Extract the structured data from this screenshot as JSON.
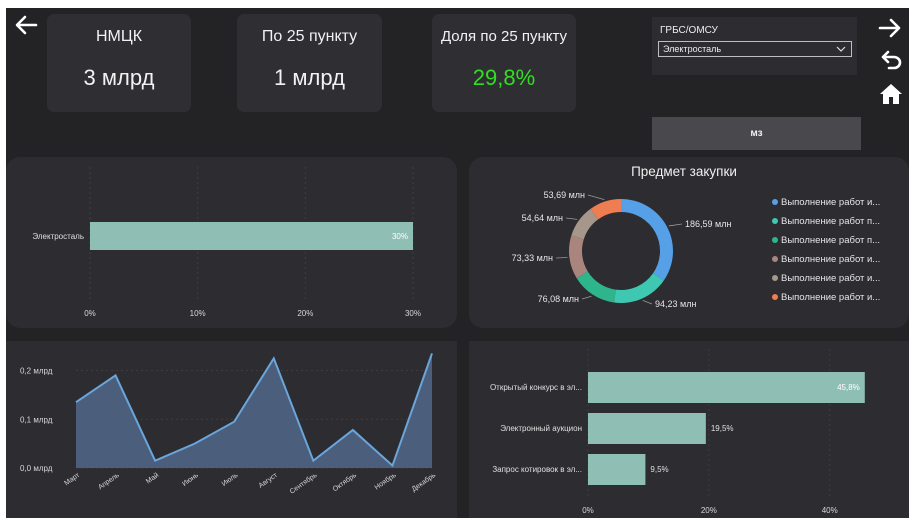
{
  "kpi": {
    "nmck": {
      "title": "НМЦК",
      "value": "3 млрд"
    },
    "p25": {
      "title": "По 25 пункту",
      "value": "1 млрд"
    },
    "share": {
      "title": "Доля по 25 пункту",
      "value": "29,8%",
      "color": "#33dd22"
    }
  },
  "filter": {
    "label": "ГРБС/ОМСУ",
    "selected": "Электросталь"
  },
  "mz_button": "мз",
  "nav": {
    "back_icon": "arrow-left-icon",
    "forward_icon": "arrow-right-icon",
    "undo_icon": "undo-icon",
    "home_icon": "home-icon"
  },
  "chart_data": [
    {
      "type": "bar",
      "orientation": "horizontal",
      "categories": [
        "Электросталь"
      ],
      "values": [
        30
      ],
      "data_labels": [
        "30%"
      ],
      "xticks": [
        "0%",
        "10%",
        "20%",
        "30%"
      ],
      "xlim": [
        0,
        30
      ],
      "color": "#8fbfb4"
    },
    {
      "type": "pie",
      "variant": "donut",
      "title": "Предмет закупки",
      "slices": [
        {
          "legend": "Выполнение работ и...",
          "value": 186.59,
          "label": "186,59 млн",
          "color": "#56a0e8"
        },
        {
          "legend": "Выполнение работ п...",
          "value": 94.23,
          "label": "94,23 млн",
          "color": "#3ec8b2"
        },
        {
          "legend": "Выполнение работ п...",
          "value": 76.08,
          "label": "76,08 млн",
          "color": "#2fb58c"
        },
        {
          "legend": "Выполнение работ и...",
          "value": 73.33,
          "label": "73,33 млн",
          "color": "#a9857e"
        },
        {
          "legend": "Выполнение работ и...",
          "value": 54.64,
          "label": "54,64 млн",
          "color": "#a6978a"
        },
        {
          "legend": "Выполнение работ и...",
          "value": 53.69,
          "label": "53,69 млн",
          "color": "#ee7d52"
        }
      ]
    },
    {
      "type": "area",
      "categories": [
        "Март",
        "Апрель",
        "Май",
        "Июнь",
        "Июль",
        "Август",
        "Сентябрь",
        "Октябрь",
        "Ноябрь",
        "Декабрь"
      ],
      "values": [
        0.135,
        0.19,
        0.015,
        0.05,
        0.095,
        0.225,
        0.015,
        0.078,
        0.005,
        0.235
      ],
      "yticks": [
        {
          "v": 0.0,
          "label": "0,0 млрд"
        },
        {
          "v": 0.1,
          "label": "0,1 млрд"
        },
        {
          "v": 0.2,
          "label": "0,2 млрд"
        }
      ],
      "ylim": [
        0,
        0.24
      ],
      "line_color": "#6aa6dc",
      "fill_color": "#4b5f7c"
    },
    {
      "type": "bar",
      "orientation": "horizontal",
      "categories": [
        "Открытый конкурс в эл...",
        "Электронный аукцион",
        "Запрос котировок в эл..."
      ],
      "values": [
        45.8,
        19.5,
        9.5
      ],
      "data_labels": [
        "45,8%",
        "19,5%",
        "9,5%"
      ],
      "xticks": [
        {
          "v": 0,
          "label": "0%"
        },
        {
          "v": 20,
          "label": "20%"
        },
        {
          "v": 40,
          "label": "40%"
        }
      ],
      "xlim": [
        0,
        46
      ],
      "color": "#8fbfb4"
    }
  ]
}
